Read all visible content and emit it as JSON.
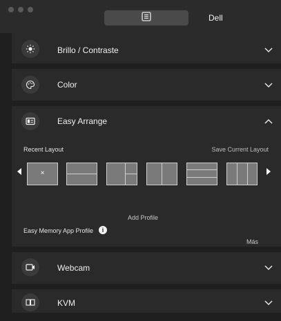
{
  "window": {
    "tab_active_icon": "list-document-icon",
    "tab_label": "Dell"
  },
  "sections": {
    "brillo": {
      "title": "Brillo / Contraste",
      "icon": "sun-icon"
    },
    "color": {
      "title": "Color",
      "icon": "palette-icon"
    },
    "easy_arrange": {
      "title": "Easy Arrange",
      "icon": "layout-icon",
      "recent_layout_label": "Recent Layout",
      "save_layout_label": "Save Current Layout",
      "selected_layout_mark": "×",
      "memory_profile_label": "Easy Memory App Profile",
      "info_mark": "i",
      "add_profile_label": "Add Profile",
      "more_label": "Más"
    },
    "webcam": {
      "title": "Webcam",
      "icon": "camera-icon"
    },
    "kvm": {
      "title": "KVM",
      "icon": "kvm-icon"
    }
  },
  "colors": {
    "background": "#1f1f1f",
    "panel": "#2a2a2a",
    "accent": "#4a4a4a"
  }
}
